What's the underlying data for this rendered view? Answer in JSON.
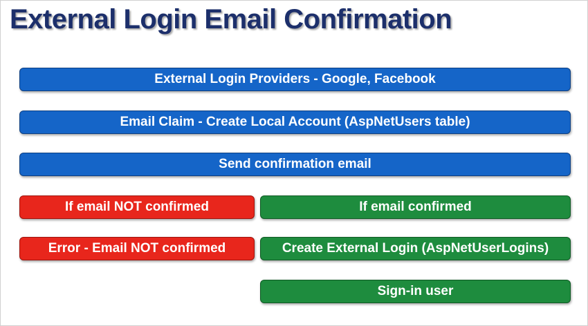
{
  "title": "External Login Email Confirmation",
  "steps": {
    "providers": "External Login Providers - Google, Facebook",
    "email_claim": "Email Claim - Create Local Account (AspNetUsers table)",
    "send_email": "Send confirmation email",
    "not_confirmed": "If email NOT confirmed",
    "confirmed": "If email confirmed",
    "error": "Error - Email NOT confirmed",
    "create_login": "Create External Login (AspNetUserLogins)",
    "sign_in": "Sign-in user"
  },
  "colors": {
    "title": "#1c2f6b",
    "blue": "#1565c8",
    "red": "#e8261c",
    "green": "#1e8c3e"
  }
}
